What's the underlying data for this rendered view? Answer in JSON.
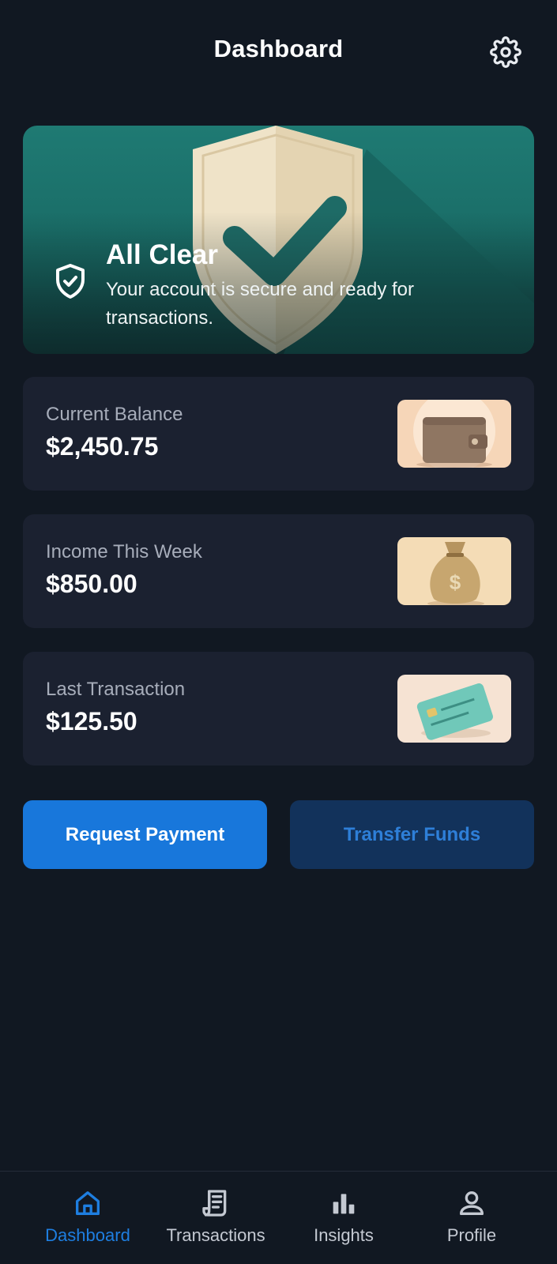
{
  "header": {
    "title": "Dashboard",
    "settings_icon": "gear-icon"
  },
  "hero": {
    "title": "All Clear",
    "message": "Your account is secure and ready for transactions.",
    "icon": "shield-check-icon",
    "colors": {
      "background": "#1f7a73",
      "shield": "#efe3c8",
      "check": "#1e6b66"
    }
  },
  "cards": [
    {
      "label": "Current Balance",
      "value": "$2,450.75",
      "thumbnail": "wallet-icon"
    },
    {
      "label": "Income This Week",
      "value": "$850.00",
      "thumbnail": "money-bag-icon"
    },
    {
      "label": "Last Transaction",
      "value": "$125.50",
      "thumbnail": "credit-card-icon"
    }
  ],
  "actions": {
    "primary_label": "Request Payment",
    "secondary_label": "Transfer Funds"
  },
  "nav": {
    "active": "Dashboard",
    "items": [
      {
        "label": "Dashboard",
        "icon": "home-icon"
      },
      {
        "label": "Transactions",
        "icon": "receipt-icon"
      },
      {
        "label": "Insights",
        "icon": "bar-chart-icon"
      },
      {
        "label": "Profile",
        "icon": "user-icon"
      }
    ]
  },
  "colors": {
    "background": "#111822",
    "card": "#1b2130",
    "accent": "#1877db",
    "accent_dark": "#12325b",
    "muted_text": "#a7adba"
  }
}
